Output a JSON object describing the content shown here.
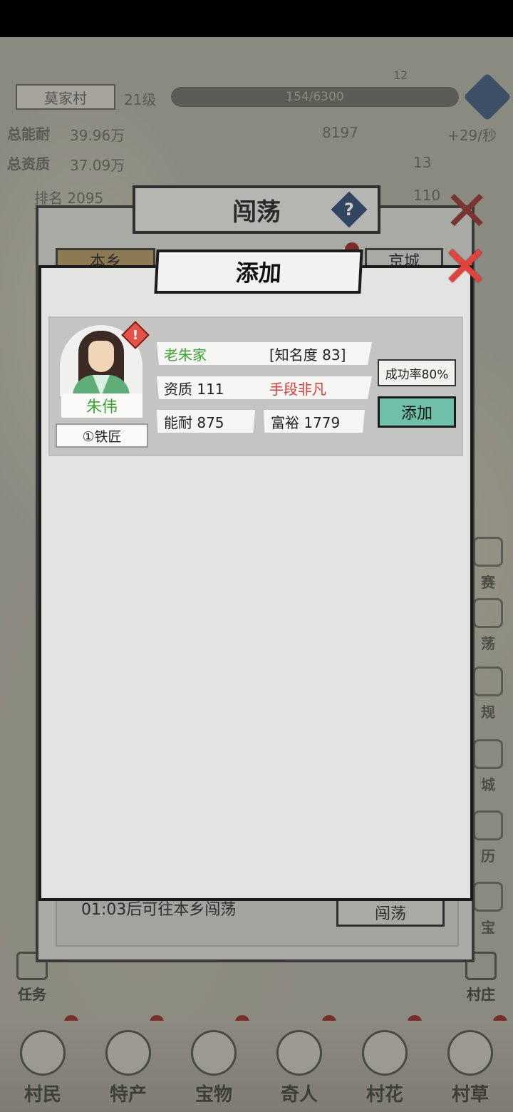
{
  "hud": {
    "village_name": "莫家村",
    "level": "21级",
    "exp": "154/6300",
    "stat1_label": "总能耐",
    "stat1_value": "39.96万",
    "stat2_label": "总资质",
    "stat2_value": "37.09万",
    "rank": "排名 2095",
    "coins": "8197",
    "coin_rate": "+29/秒",
    "value_13": "13",
    "value_110": "110",
    "map_badge": "12"
  },
  "side_buttons": [
    "赛",
    "荡",
    "规",
    "城",
    "历",
    "宝"
  ],
  "bottom_nav": [
    "村民",
    "特产",
    "宝物",
    "奇人",
    "村花",
    "村草"
  ],
  "corner": {
    "task": "任务",
    "village": "村庄"
  },
  "outer_panel": {
    "title": "闯荡",
    "help": "?",
    "close": "✕",
    "tab_left": "本乡",
    "tab_right": "京城",
    "footer_text": "01:03后可往本乡闯荡",
    "footer_button": "闯荡"
  },
  "dialog": {
    "title": "添加",
    "close": "✕",
    "card": {
      "name": "朱伟",
      "job": "①铁匠",
      "family": "老朱家",
      "fame": "[知名度 83]",
      "aptitude": "资质  111",
      "trait": "手段非凡",
      "ability": "能耐  875",
      "wealth": "富裕   1779",
      "success_rate": "成功率80%",
      "add_button": "添加",
      "alert": "!"
    }
  },
  "colors": {
    "green_text": "#3ca632",
    "red_text": "#e23a32",
    "add_button": "#6ec0a8",
    "close_red": "#e2413c"
  }
}
